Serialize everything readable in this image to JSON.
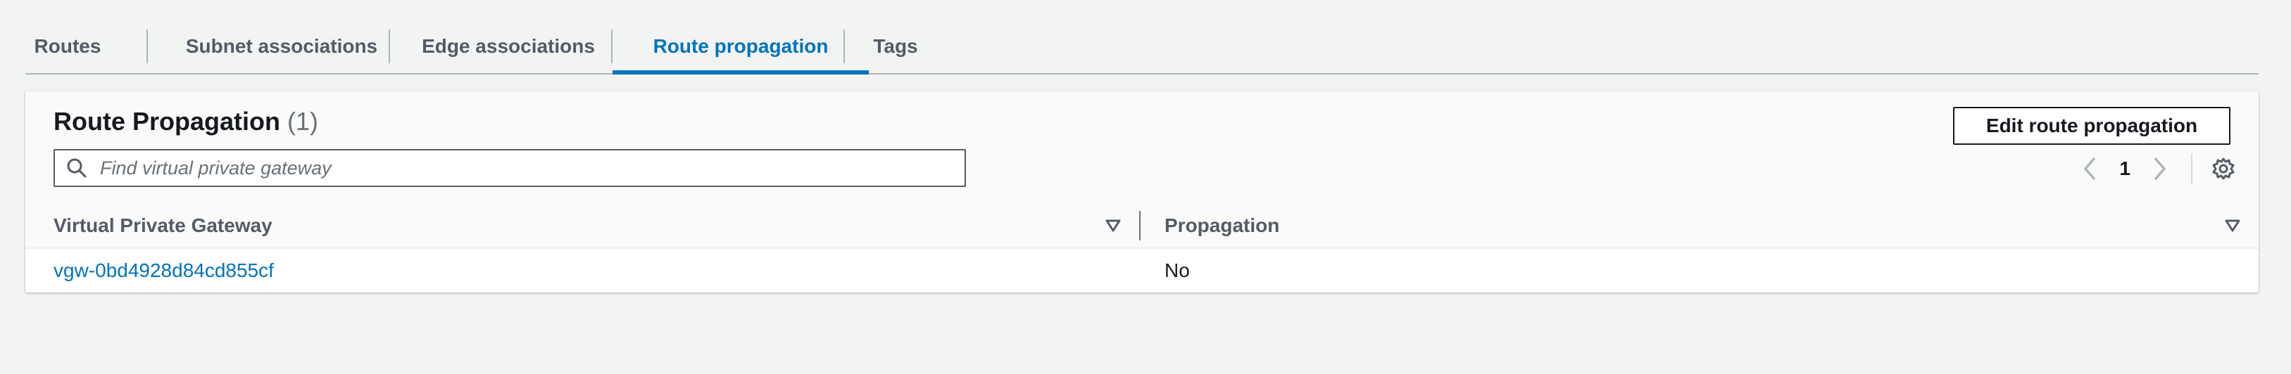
{
  "tabs": [
    {
      "label": "Routes"
    },
    {
      "label": "Subnet associations"
    },
    {
      "label": "Edge associations"
    },
    {
      "label": "Route propagation",
      "active": true
    },
    {
      "label": "Tags"
    }
  ],
  "panel": {
    "title": "Route Propagation",
    "count": "(1)",
    "edit_button": "Edit route propagation",
    "search_placeholder": "Find virtual private gateway",
    "page": "1"
  },
  "table": {
    "columns": [
      "Virtual Private Gateway",
      "Propagation"
    ],
    "rows": [
      {
        "gateway": "vgw-0bd4928d84cd855cf",
        "propagation": "No"
      }
    ]
  },
  "colors": {
    "accent": "#0073bb",
    "background": "#f2f3f3"
  }
}
